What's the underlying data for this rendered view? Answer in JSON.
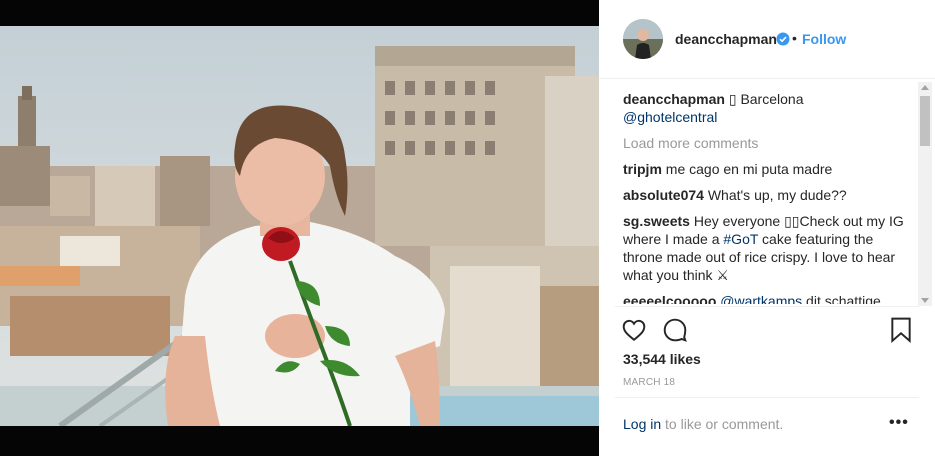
{
  "post": {
    "username": "deancchapman",
    "follow_label": "Follow",
    "dot": "•",
    "caption": {
      "user": "deancchapman",
      "emoji": "▯",
      "location": "Barcelona",
      "mention": "@ghotelcentral"
    },
    "load_more": "Load more comments",
    "comments": [
      {
        "user": "tripjm",
        "text": "me cago en mi puta madre"
      },
      {
        "user": "absolute074",
        "text": "What's up, my dude??"
      },
      {
        "user": "sg.sweets",
        "text_before": "Hey everyone ▯▯Check out my IG where I made a ",
        "tag": "#GoT",
        "text_after": " cake featuring the throne made out of rice crispy. I love to hear what you think ⚔"
      },
      {
        "user": "eeeeelcooooo",
        "mention": "@wartkamps",
        "text": " dit schattige"
      }
    ],
    "likes": "33,544 likes",
    "date": "MARCH 18",
    "login_link": "Log in",
    "login_rest": " to like or comment.",
    "more_label": "•••"
  },
  "icons": {
    "like": "heart-icon",
    "comment": "comment-icon",
    "save": "bookmark-icon",
    "verified": "verified-badge-icon"
  },
  "colors": {
    "follow": "#3897f0",
    "link": "#003569",
    "muted": "#999999",
    "text": "#262626"
  }
}
